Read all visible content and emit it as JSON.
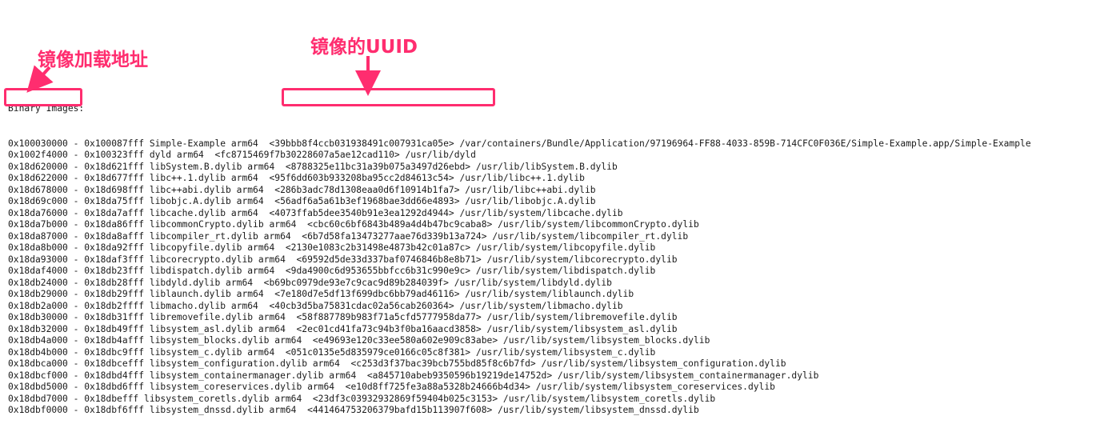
{
  "annotations": {
    "uuid_label": "镜像的UUID",
    "address_label": "镜像加载地址"
  },
  "colors": {
    "annotation": "#ff2d6f",
    "text": "#1a1a1a",
    "background": "#ffffff"
  },
  "log": {
    "header": "Binary Images:",
    "lines": [
      "0x100030000 - 0x100087fff Simple-Example arm64  <39bbb8f4ccb031938491c007931ca05e> /var/containers/Bundle/Application/97196964-FF88-4033-859B-714CFC0F036E/Simple-Example.app/Simple-Example",
      "0x1002f4000 - 0x100323fff dyld arm64  <fc8715469f7b30228607a5ae12cad110> /usr/lib/dyld",
      "0x18d620000 - 0x18d621fff libSystem.B.dylib arm64  <8788325e11bc31a39b075a3497d26ebd> /usr/lib/libSystem.B.dylib",
      "0x18d622000 - 0x18d677fff libc++.1.dylib arm64  <95f6dd603b933208ba95cc2d84613c54> /usr/lib/libc++.1.dylib",
      "0x18d678000 - 0x18d698fff libc++abi.dylib arm64  <286b3adc78d1308eaa0d6f10914b1fa7> /usr/lib/libc++abi.dylib",
      "0x18d69c000 - 0x18da75fff libobjc.A.dylib arm64  <56adf6a5a61b3ef1968bae3dd66e4893> /usr/lib/libobjc.A.dylib",
      "0x18da76000 - 0x18da7afff libcache.dylib arm64  <4073ffab5dee3540b91e3ea1292d4944> /usr/lib/system/libcache.dylib",
      "0x18da7b000 - 0x18da86fff libcommonCrypto.dylib arm64  <cbc60c6bf6843b489a4d4b47bc9caba8> /usr/lib/system/libcommonCrypto.dylib",
      "0x18da87000 - 0x18da8afff libcompiler_rt.dylib arm64  <6b7d58fa13473277aae76d339b13a724> /usr/lib/system/libcompiler_rt.dylib",
      "0x18da8b000 - 0x18da92fff libcopyfile.dylib arm64  <2130e1083c2b31498e4873b42c01a87c> /usr/lib/system/libcopyfile.dylib",
      "0x18da93000 - 0x18daf3fff libcorecrypto.dylib arm64  <69592d5de33d337baf0746846b8e8b71> /usr/lib/system/libcorecrypto.dylib",
      "0x18daf4000 - 0x18db23fff libdispatch.dylib arm64  <9da4900c6d953655bbfcc6b31c990e9c> /usr/lib/system/libdispatch.dylib",
      "0x18db24000 - 0x18db28fff libdyld.dylib arm64  <b69bc0979de93e7c9cac9d89b284039f> /usr/lib/system/libdyld.dylib",
      "0x18db29000 - 0x18db29fff liblaunch.dylib arm64  <7e180d7e5df13f699dbc6bb79ad46116> /usr/lib/system/liblaunch.dylib",
      "0x18db2a000 - 0x18db2ffff libmacho.dylib arm64  <40cb3d5ba75831cdac02a56cab260364> /usr/lib/system/libmacho.dylib",
      "0x18db30000 - 0x18db31fff libremovefile.dylib arm64  <58f887789b983f71a5cfd5777958da77> /usr/lib/system/libremovefile.dylib",
      "0x18db32000 - 0x18db49fff libsystem_asl.dylib arm64  <2ec01cd41fa73c94b3f0ba16aacd3858> /usr/lib/system/libsystem_asl.dylib",
      "0x18db4a000 - 0x18db4afff libsystem_blocks.dylib arm64  <e49693e120c33ee580a602e909c83abe> /usr/lib/system/libsystem_blocks.dylib",
      "0x18db4b000 - 0x18dbc9fff libsystem_c.dylib arm64  <051c0135e5d835979ce0166c05c8f381> /usr/lib/system/libsystem_c.dylib",
      "0x18dbca000 - 0x18dbcefff libsystem_configuration.dylib arm64  <c253d3f37bac39bcb755bd85f8c6b7fd> /usr/lib/system/libsystem_configuration.dylib",
      "0x18dbcf000 - 0x18dbd4fff libsystem_containermanager.dylib arm64  <a845710abeb9350596b19219de14752d> /usr/lib/system/libsystem_containermanager.dylib",
      "0x18dbd5000 - 0x18dbd6fff libsystem_coreservices.dylib arm64  <e10d8ff725fe3a88a5328b24666b4d34> /usr/lib/system/libsystem_coreservices.dylib",
      "0x18dbd7000 - 0x18dbefff libsystem_coretls.dylib arm64  <23df3c03932932869f59404b025c3153> /usr/lib/system/libsystem_coretls.dylib",
      "0x18dbf0000 - 0x18dbf6fff libsystem_dnssd.dylib arm64  <441464753206379bafd15b113907f608> /usr/lib/system/libsystem_dnssd.dylib"
    ]
  }
}
